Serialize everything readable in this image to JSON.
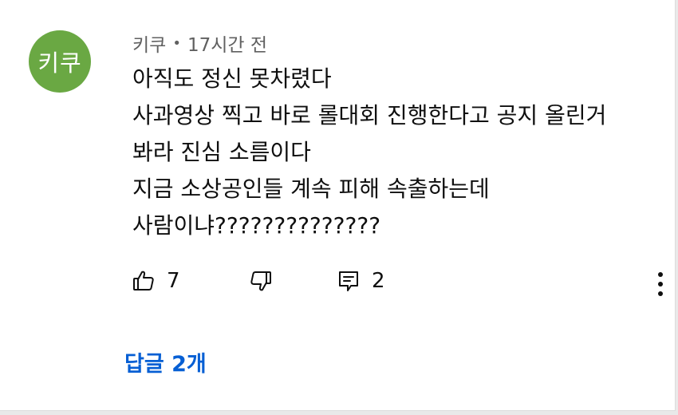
{
  "comment": {
    "avatar": {
      "text": "키쿠",
      "color": "#6aa843"
    },
    "author": "키쿠",
    "separator": "•",
    "time": "17시간 전",
    "lines": [
      "아직도 정신 못차렸다",
      "사과영상 찍고 바로 롤대회 진행한다고 공지 올린거",
      "봐라 진심 소름이다",
      "지금 소상공인들 계속 피해 속출하는데",
      "사람이냐??????????????"
    ]
  },
  "actions": {
    "like": {
      "icon": "thumb-up-icon",
      "count": "7"
    },
    "dislike": {
      "icon": "thumb-down-icon"
    },
    "reply": {
      "icon": "reply-comment-icon",
      "count": "2"
    },
    "more": {
      "icon": "more-vert-icon"
    }
  },
  "replies": {
    "label": "답글 2개",
    "color": "#065fd4"
  }
}
